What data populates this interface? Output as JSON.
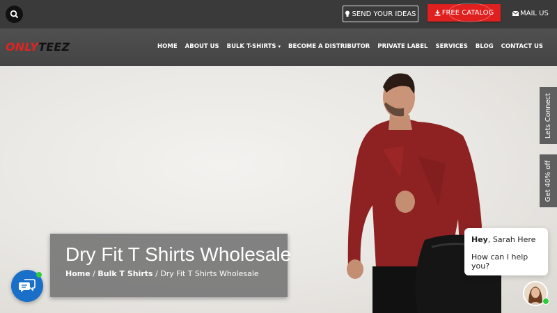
{
  "topbar": {
    "send_ideas": "SEND YOUR IDEAS",
    "free_catalog": "FREE CATALOG",
    "mail_us": "MAIL US"
  },
  "logo": {
    "part1": "ONLY",
    "part2": "TEEZ"
  },
  "nav": {
    "items": [
      "HOME",
      "ABOUT US",
      "BULK T-SHIRTS",
      "BECOME A DISTRIBUTOR",
      "PRIVATE LABEL",
      "SERVICES",
      "BLOG",
      "CONTACT US"
    ]
  },
  "hero": {
    "title": "Dry Fit T Shirts Wholesale",
    "breadcrumb": {
      "home": "Home",
      "sep": " / ",
      "bulk": "Bulk T Shirts",
      "current": "Dry Fit T Shirts Wholesale"
    }
  },
  "side_tabs": {
    "connect": "Lets Connect",
    "offer": "Get 40% off"
  },
  "chat": {
    "greeting_bold": "Hey",
    "greeting_rest": ", Sarah Here",
    "help": "How can I help you?"
  },
  "colors": {
    "accent": "#e01f1f",
    "chat": "#1a6fc9",
    "online": "#2ecc40"
  }
}
